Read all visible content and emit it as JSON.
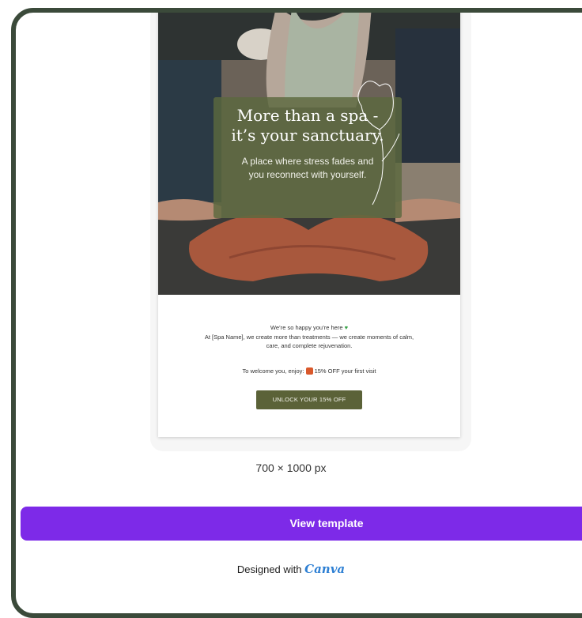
{
  "template": {
    "headline_line1": "More than a spa -",
    "headline_line2": "it’s your sanctuary.",
    "subhead_line1": "A place where stress fades and",
    "subhead_line2": "you reconnect with yourself.",
    "greeting": "We’re so happy you’re here",
    "intro_line1": "At [Spa Name], we create more than treatments — we create moments of calm,",
    "intro_line2": "care, and complete rejuvenation.",
    "offer_prefix": "To welcome you, enjoy:",
    "offer_text": "15% OFF your first visit",
    "cta_label": "UNLOCK YOUR 15% OFF"
  },
  "dimensions": "700 × 1000 px",
  "view_template_label": "View template",
  "designed_with_label": "Designed with",
  "brand_name": "Canva",
  "colors": {
    "frame_border": "#3b4a3a",
    "overlay": "#5c693e",
    "cta_button": "#5b6238",
    "view_button": "#7d2ae8",
    "brand": "#2d7fd3"
  },
  "icons": {
    "heart": "green-heart-icon",
    "gift": "gift-icon",
    "tulip": "tulip-line-art-icon"
  }
}
